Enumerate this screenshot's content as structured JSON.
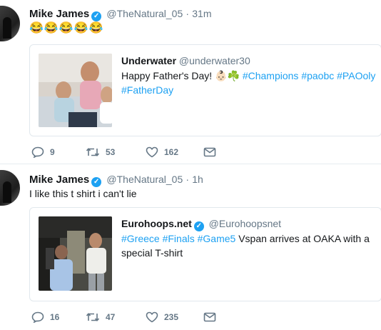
{
  "tweets": [
    {
      "name": "Mike James",
      "handle": "@TheNatural_05",
      "separator": "·",
      "time": "31m",
      "text": "😂😂😂😂😂",
      "quote": {
        "name": "Underwater",
        "handle": "@underwater30",
        "text_prefix": "Happy Father's Day! 👶🏻☘️ ",
        "hashtags": [
          "#Champions",
          "#paobc",
          "#PAOoly",
          "#FatherDay"
        ]
      },
      "actions": {
        "replies": "9",
        "retweets": "53",
        "likes": "162"
      }
    },
    {
      "name": "Mike James",
      "handle": "@TheNatural_05",
      "separator": "·",
      "time": "1h",
      "text": "I like this t shirt i can't lie",
      "quote": {
        "name": "Eurohoops.net",
        "handle": "@Eurohoopsnet",
        "hashtags": [
          "#Greece",
          "#Finals",
          "#Game5"
        ],
        "text_suffix": "Vspan arrives at OAKA with a special T-shirt"
      },
      "actions": {
        "replies": "16",
        "retweets": "47",
        "likes": "235"
      }
    }
  ],
  "icons": [
    "reply-icon",
    "retweet-icon",
    "like-icon",
    "message-icon",
    "verified-icon"
  ],
  "colors": {
    "link": "#1da1f2",
    "secondary": "#657786",
    "border": "#e1e8ed"
  }
}
